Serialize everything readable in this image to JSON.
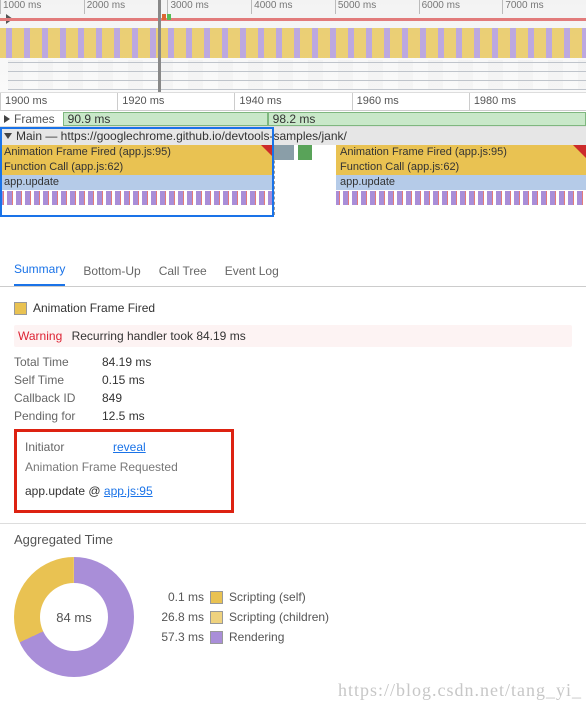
{
  "overview": {
    "ticks": [
      "1000 ms",
      "2000 ms",
      "3000 ms",
      "4000 ms",
      "5000 ms",
      "6000 ms",
      "7000 ms"
    ]
  },
  "ruler": {
    "ticks": [
      "1900 ms",
      "1920 ms",
      "1940 ms",
      "1960 ms",
      "1980 ms"
    ]
  },
  "frames": {
    "label": "Frames",
    "seg1": "90.9 ms",
    "seg2": "98.2 ms"
  },
  "main": {
    "label": "Main — https://googlechrome.github.io/devtools-samples/jank/"
  },
  "bars": {
    "aff": "Animation Frame Fired (app.js:95)",
    "fc": "Function Call (app.js:62)",
    "au": "app.update"
  },
  "tabs": {
    "summary": "Summary",
    "bottomup": "Bottom-Up",
    "calltree": "Call Tree",
    "eventlog": "Event Log"
  },
  "event": {
    "name": "Animation Frame Fired",
    "warning_label": "Warning",
    "warning_text": "Recurring handler took 84.19 ms",
    "total_time_k": "Total Time",
    "total_time_v": "84.19 ms",
    "self_time_k": "Self Time",
    "self_time_v": "0.15 ms",
    "callback_k": "Callback ID",
    "callback_v": "849",
    "pending_k": "Pending for",
    "pending_v": "12.5 ms",
    "initiator_k": "Initiator",
    "initiator_link": "reveal",
    "requested": "Animation Frame Requested",
    "stack_fn": "app.update @ ",
    "stack_src": "app.js:95"
  },
  "agg": {
    "title": "Aggregated Time",
    "center": "84 ms",
    "rows": [
      {
        "t": "0.1 ms",
        "l": "Scripting (self)"
      },
      {
        "t": "26.8 ms",
        "l": "Scripting (children)"
      },
      {
        "t": "57.3 ms",
        "l": "Rendering"
      }
    ]
  },
  "watermark": "https://blog.csdn.net/tang_yi_"
}
